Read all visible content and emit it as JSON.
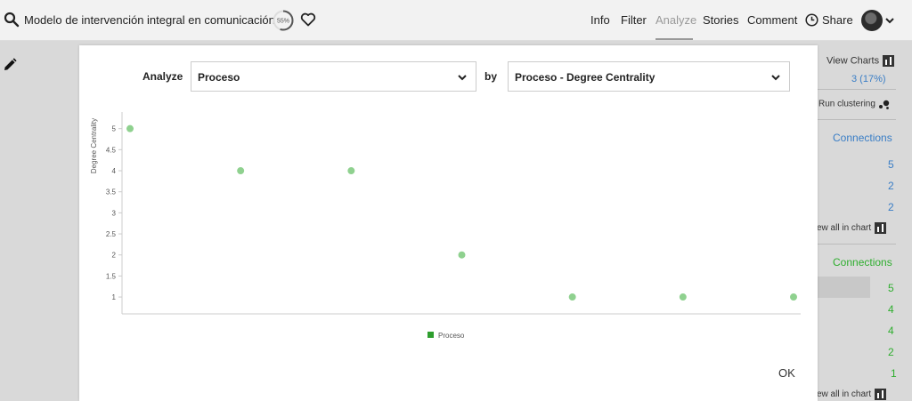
{
  "header": {
    "title": "Modelo de intervención integral en comunicación",
    "progress": "55%",
    "progress_value": 55,
    "nav": [
      "Info",
      "Filter",
      "Analyze",
      "Stories",
      "Comment"
    ],
    "active_nav": "Analyze",
    "share_label": "Share"
  },
  "background_panel": {
    "view_charts_label": "View Charts",
    "count_label": "3 (17%)",
    "run_clustering_label": "Run clustering",
    "connections_label_1": "Connections",
    "values_1": [
      "5",
      "2",
      "2"
    ],
    "view_all_label_1": "ew all in chart",
    "connections_label_2": "Connections",
    "values_2": [
      "5",
      "4",
      "4",
      "2",
      "1"
    ],
    "view_all_label_2": "ew all in chart",
    "colors": {
      "blue": "#3a7ec6",
      "green": "#2fae2f"
    }
  },
  "modal": {
    "analyze_label": "Analyze",
    "analyze_value": "Proceso",
    "by_label": "by",
    "by_value": "Proceso - Degree Centrality",
    "ok_label": "OK"
  },
  "chart_data": {
    "type": "scatter",
    "ylabel": "Degree Centrality",
    "xlabel": "",
    "ylim": [
      0.6,
      5.5
    ],
    "yticks": [
      "5",
      "4.5",
      "4",
      "3.5",
      "3",
      "2.5",
      "2",
      "1.5",
      "1"
    ],
    "series": [
      {
        "name": "Proceso",
        "color": "#8fd18f",
        "legend_color": "#2e9e2e",
        "values": [
          5,
          4,
          4,
          2,
          1,
          1,
          1
        ]
      }
    ],
    "grid": false,
    "legend_position": "bottom-center"
  }
}
